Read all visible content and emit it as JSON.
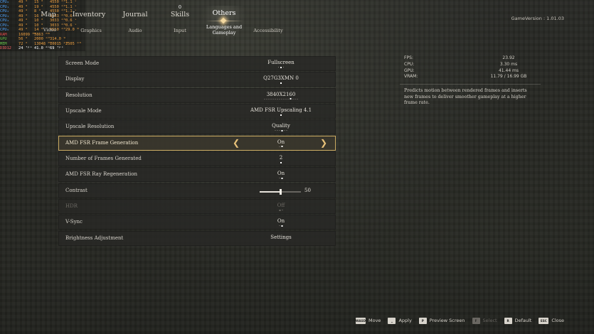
{
  "perf_overlay": {
    "rows": [
      {
        "label": "CPU₀",
        "c1": "49 °",
        "c2": "15 °",
        "c3": "4550 ᵐᴴ",
        "c4": "1.1 ᵛ",
        "kind": "cpu"
      },
      {
        "label": "CPU₁",
        "c1": "49 °",
        "c2": "19 °",
        "c3": "4550 ᵐᴴ",
        "c4": "1.1 ᵛ",
        "kind": "cpu"
      },
      {
        "label": "CPU₂",
        "c1": "49 °",
        "c2": "8 °",
        "c3": "4550 ᵐᴴ",
        "c4": "1.1 ᵛ",
        "kind": "cpu"
      },
      {
        "label": "CPU₃",
        "c1": "49 °",
        "c2": "16 °",
        "c3": "3033 ᵐᴴ",
        "c4": "0.6 ᵛ",
        "kind": "cpu"
      },
      {
        "label": "CPU₄",
        "c1": "49 °",
        "c2": "10 °",
        "c3": "3033 ᵐᴴ",
        "c4": "0.6 ᵛ",
        "kind": "cpu"
      },
      {
        "label": "CPU₅",
        "c1": "49 °",
        "c2": "10 °",
        "c3": "3033 ᵐᴴ",
        "c4": "0.6 ᵛ",
        "kind": "cpu"
      },
      {
        "label": "CPU₆",
        "c1": "49 °",
        "c2": "14 °",
        "c3": "4550 ᵐᴴ",
        "c4": "29.0 ᵂ",
        "kind": "cpu"
      },
      {
        "label": "RAM",
        "c1": "16099 ᴹᴮ",
        "c2": "5863 ᴹᴮ",
        "c3": "",
        "c4": "",
        "kind": "mem"
      },
      {
        "label": "GPU",
        "c1": "56 °",
        "c2": "2000 ᵐᴴ",
        "c3": "314.0 ᵂ",
        "c4": "",
        "kind": "gpu"
      },
      {
        "label": "MEM",
        "c1": "72 °",
        "c2": "13048 ᴹᴮ",
        "c3": "10015 ᵐᴴ",
        "c4": "2505 ᵐᴴ",
        "kind": "gpu"
      },
      {
        "label": "D3D12",
        "c1": "24 ᶠᵖˢ",
        "c2": "41.0 ᵐˢ",
        "c3": "69 ᶠᵖˢ",
        "c4": "",
        "kind": "fps"
      }
    ]
  },
  "nav": {
    "tabs": [
      "Map",
      "Inventory",
      "Journal",
      "Skills",
      "Others"
    ],
    "skills_badge": "0",
    "active_tab": "Others",
    "subtabs": [
      "Video",
      "Graphics",
      "Audio",
      "Input",
      "Languages and Gameplay",
      "Accessibility"
    ]
  },
  "game_version": "GameVersion : 1.01.03",
  "settings": [
    {
      "label": "Screen Mode",
      "value": "Fullscreen",
      "dots": 3,
      "active_dot": 1
    },
    {
      "label": "Display",
      "value": "Q27G3XMN 0",
      "dots": 1,
      "active_dot": 0
    },
    {
      "label": "Resolution",
      "value": "3840X2160",
      "dots": 16,
      "active_dot": 12
    },
    {
      "label": "Upscale Mode",
      "value": "AMD FSR Upscaling 4.1",
      "dots": 1,
      "active_dot": 0
    },
    {
      "label": "Upscale Resolution",
      "value": "Quality",
      "dots": 6,
      "active_dot": 3
    },
    {
      "label": "AMD FSR Frame Generation",
      "value": "On",
      "dots": 2,
      "active_dot": 1,
      "selected": true
    },
    {
      "label": "Number of Frames Generated",
      "value": "2",
      "dots": 1,
      "active_dot": 0
    },
    {
      "label": "AMD FSR Ray Regeneration",
      "value": "On",
      "dots": 2,
      "active_dot": 1
    },
    {
      "label": "Contrast",
      "slider": true,
      "value": "50",
      "fraction": 0.5
    },
    {
      "label": "HDR",
      "value": "Off",
      "dots": 2,
      "active_dot": 0,
      "disabled": true
    },
    {
      "label": "V-Sync",
      "value": "On",
      "dots": 2,
      "active_dot": 1
    },
    {
      "label": "Brightness Adjustment",
      "value": "Settings",
      "dots": 0
    }
  ],
  "stats": [
    {
      "label": "FPS:",
      "value": "23.92"
    },
    {
      "label": "CPU:",
      "value": "3.30  ms"
    },
    {
      "label": "GPU:",
      "value": "41.44  ms"
    },
    {
      "label": "VRAM:",
      "value": "11.79  /  16.99  GB"
    }
  ],
  "description": "Predicts motion between rendered frames and inserts new frames to deliver smoother gameplay at a higher frame rate.",
  "controls": [
    {
      "key": "WASD",
      "label": "Move",
      "icon": "wasd-key-icon"
    },
    {
      "key": "⎵",
      "label": "Apply",
      "icon": "space-key-icon"
    },
    {
      "key": "P",
      "label": "Preview Screen",
      "icon": "p-key-icon"
    },
    {
      "key": "F",
      "label": "Select",
      "icon": "f-key-icon",
      "disabled": true
    },
    {
      "key": "R",
      "label": "Default",
      "icon": "r-key-icon"
    },
    {
      "key": "ESC",
      "label": "Close",
      "icon": "esc-key-icon"
    }
  ]
}
